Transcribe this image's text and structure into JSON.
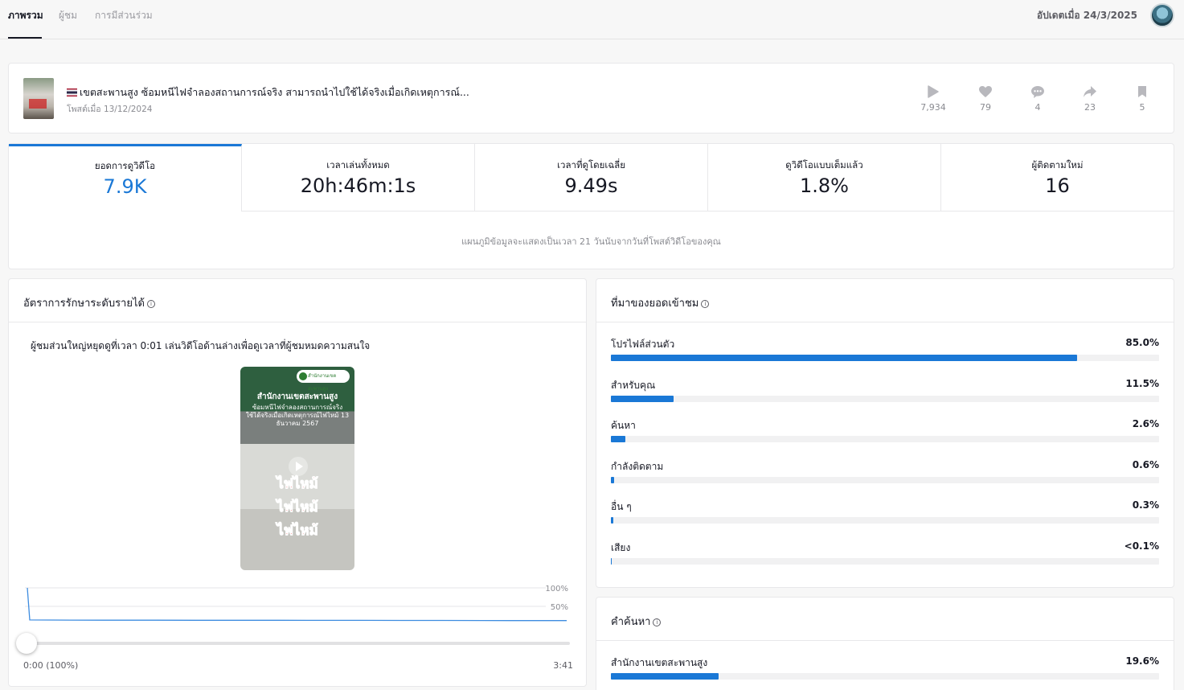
{
  "nav": {
    "tabs": [
      {
        "label": "ภาพรวม",
        "active": true
      },
      {
        "label": "ผู้ชม",
        "active": false
      },
      {
        "label": "การมีส่วนร่วม",
        "active": false
      }
    ],
    "updated": "อัปเดตเมื่อ 24/3/2025"
  },
  "video": {
    "title": "เขตสะพานสูง ซ้อมหนีไฟจำลองสถานการณ์จริง สามารถนำไปใช้ได้จริงเมื่อเกิดเหตุการณ์...",
    "posted": "โพสต์เมื่อ 13/12/2024",
    "stats": [
      {
        "icon": "play-icon",
        "value": "7,934"
      },
      {
        "icon": "heart-icon",
        "value": "79"
      },
      {
        "icon": "comment-icon",
        "value": "4"
      },
      {
        "icon": "share-icon",
        "value": "23"
      },
      {
        "icon": "bookmark-icon",
        "value": "5"
      }
    ]
  },
  "metrics": {
    "items": [
      {
        "label": "ยอดการดูวิดีโอ",
        "value": "7.9K",
        "selected": true
      },
      {
        "label": "เวลาเล่นทั้งหมด",
        "value": "20h:46m:1s",
        "selected": false
      },
      {
        "label": "เวลาที่ดูโดยเฉลี่ย",
        "value": "9.49s",
        "selected": false
      },
      {
        "label": "ดูวิดีโอแบบเต็มแล้ว",
        "value": "1.8%",
        "selected": false
      },
      {
        "label": "ผู้ติดตามใหม่",
        "value": "16",
        "selected": false
      }
    ],
    "note": "แผนภูมิข้อมูลจะแสดงเป็นเวลา 21 วันนับจากวันที่โพสต์วิดีโอของคุณ",
    "accent": "#1a78d6"
  },
  "retention": {
    "title": "อัตราการรักษาระดับรายได้",
    "info_icon": "ⓘ",
    "description": "ผู้ชมส่วนใหญ่หยุดดูที่เวลา 0:01 เล่นวิดีโอด้านล่างเพื่อดูเวลาที่ผู้ชมหมดความสนใจ",
    "video_overlay": {
      "org_logo": "สำนักงานเขตสะพานสูง",
      "headline": "สำนักงานเขตสะพานสูง",
      "subtitle": "ซ้อมหนีไฟจำลองสถานการณ์จริง ใช้ได้จริงเมื่อเกิดเหตุการณ์ไฟไหม้ 13 ธันวาคม 2567",
      "fire_text": "ไฟไหม้"
    },
    "y_labels": [
      "100%",
      "50%"
    ],
    "time_start": "0:00 (100%)",
    "time_end": "3:41",
    "curve_percent": [
      100,
      4.5,
      4.2,
      4.0,
      3.9,
      3.8,
      3.7,
      3.6,
      3.5,
      3.4,
      3.3,
      3.2,
      3.0,
      2.9,
      2.8
    ]
  },
  "traffic": {
    "title": "ที่มาของยอดเข้าชม",
    "sources": [
      {
        "label": "โปรไฟล์ส่วนตัว",
        "percent_text": "85.0%",
        "percent": 85.0
      },
      {
        "label": "สำหรับคุณ",
        "percent_text": "11.5%",
        "percent": 11.5
      },
      {
        "label": "ค้นหา",
        "percent_text": "2.6%",
        "percent": 2.6
      },
      {
        "label": "กำลังติดตาม",
        "percent_text": "0.6%",
        "percent": 0.6
      },
      {
        "label": "อื่น ๆ",
        "percent_text": "0.3%",
        "percent": 0.3
      },
      {
        "label": "เสียง",
        "percent_text": "<0.1%",
        "percent": 0.05
      }
    ]
  },
  "search_terms": {
    "title": "คำค้นหา",
    "items": [
      {
        "label": "สำนักงานเขตสะพานสูง",
        "percent_text": "19.6%",
        "percent": 19.6
      }
    ]
  }
}
